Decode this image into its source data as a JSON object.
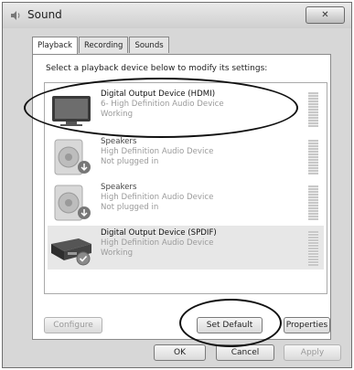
{
  "window": {
    "title": "Sound",
    "close_glyph": "✕"
  },
  "tabs": [
    {
      "label": "Playback",
      "active": true
    },
    {
      "label": "Recording",
      "active": false
    },
    {
      "label": "Sounds",
      "active": false
    }
  ],
  "panel": {
    "instruction": "Select a playback device below to modify its settings:"
  },
  "devices": [
    {
      "name": "Digital Output Device (HDMI)",
      "driver": "6- High Definition Audio Device",
      "status": "Working",
      "icon": "monitor-icon",
      "selected": true
    },
    {
      "name": "Speakers",
      "driver": "High Definition Audio Device",
      "status": "Not plugged in",
      "icon": "speaker-icon",
      "selected": false
    },
    {
      "name": "Speakers",
      "driver": "High Definition Audio Device",
      "status": "Not plugged in",
      "icon": "speaker-icon",
      "selected": false
    },
    {
      "name": "Digital Output Device (SPDIF)",
      "driver": "High Definition Audio Device",
      "status": "Working",
      "icon": "spdif-device-icon",
      "selected": false
    }
  ],
  "buttons": {
    "configure": "Configure",
    "set_default": "Set Default",
    "properties": "Properties",
    "ok": "OK",
    "cancel": "Cancel",
    "apply": "Apply"
  }
}
